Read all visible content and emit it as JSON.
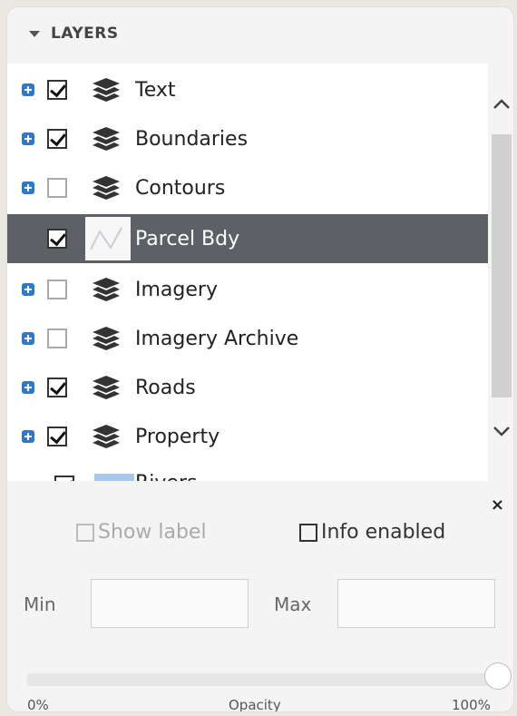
{
  "panel": {
    "title": "LAYERS"
  },
  "layers": [
    {
      "label": "Text",
      "checked": true,
      "expandable": true,
      "icon": "layers-icon"
    },
    {
      "label": "Boundaries",
      "checked": true,
      "expandable": true,
      "icon": "layers-icon"
    },
    {
      "label": "Contours",
      "checked": false,
      "expandable": true,
      "icon": "layers-icon"
    },
    {
      "label": "Parcel Bdy",
      "checked": true,
      "expandable": false,
      "icon": "line-symbol-thumbnail",
      "selected": true
    },
    {
      "label": "Imagery",
      "checked": false,
      "expandable": true,
      "icon": "layers-icon"
    },
    {
      "label": "Imagery Archive",
      "checked": false,
      "expandable": true,
      "icon": "layers-icon"
    },
    {
      "label": "Roads",
      "checked": true,
      "expandable": true,
      "icon": "layers-icon"
    },
    {
      "label": "Property",
      "checked": true,
      "expandable": true,
      "icon": "layers-icon"
    },
    {
      "label": "Rivers",
      "checked": true,
      "expandable": false,
      "icon": "area-symbol-thumbnail"
    }
  ],
  "properties": {
    "show_label": "Show label",
    "info_enabled": "Info enabled",
    "min_label": "Min",
    "max_label": "Max",
    "min_value": "",
    "max_value": "",
    "opacity_label": "Opacity",
    "opacity_min": "0%",
    "opacity_max": "100%",
    "opacity_fraction": 1.0,
    "close": "×"
  },
  "colors": {
    "selected_row": "#5d6065",
    "expander": "#2f79c8"
  }
}
